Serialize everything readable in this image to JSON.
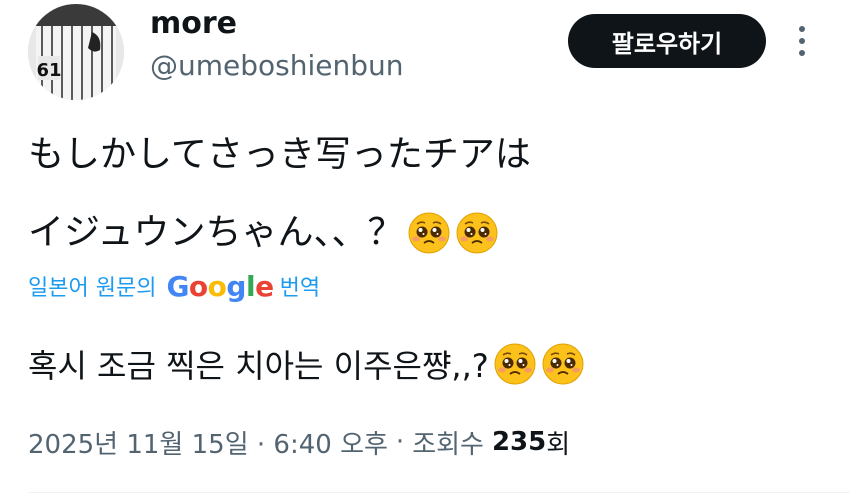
{
  "user": {
    "display_name": "more",
    "handle": "@umeboshienbun",
    "avatar_jersey_number": "61"
  },
  "follow_button": {
    "label": "팔로우하기"
  },
  "more_icon": {
    "icon": "more-vertical-icon"
  },
  "tweet": {
    "line1": "もしかしてさっき写ったチアは",
    "line2": "イジュウンちゃん、、？",
    "emoji": "pleading-face-icon"
  },
  "translation": {
    "prefix": "일본어 원문의",
    "provider": "Google",
    "suffix": "번역",
    "text": "혹시 조금 찍은 치아는 이주은쨩,,?"
  },
  "meta": {
    "timestamp": "2025년 11월 15일 · 6:40 오후",
    "separator": "·",
    "views_label": "조회수",
    "views_count": "235",
    "views_suffix": "회"
  },
  "colors": {
    "text": "#0f1419",
    "secondary": "#536471",
    "link": "#1d9bf0",
    "button_bg": "#0f1419",
    "emoji_yellow": "#fcc21b"
  }
}
